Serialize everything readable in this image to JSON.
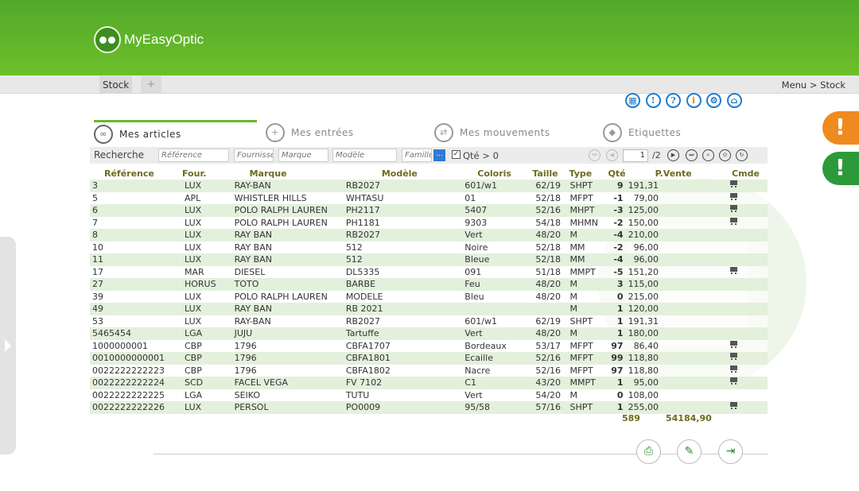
{
  "app": {
    "name": "MyEasyOptic"
  },
  "tabs": {
    "stock": "Stock",
    "add": "+"
  },
  "breadcrumb": "Menu > Stock",
  "toolbar_icons": [
    "calendar-icon",
    "info-icon",
    "help-icon",
    "info-orange-icon",
    "settings-icon",
    "home-icon"
  ],
  "alerts": {
    "orange": "!",
    "green": "!"
  },
  "nav": {
    "articles": "Mes articles",
    "entrees": "Mes entrées",
    "mouvements": "Mes mouvements",
    "etiquettes": "Etiquettes"
  },
  "search": {
    "label": "Recherche",
    "reference": "Référence",
    "fournisseur": "Fournisseur",
    "marque": "Marque",
    "modele": "Modèle",
    "famille": "Famille",
    "dots": "...",
    "qte_filter": "Qté > 0",
    "page": "1",
    "total_pages": "/2"
  },
  "columns": [
    "Référence",
    "Four.",
    "Marque",
    "Modèle",
    "Coloris",
    "Taille",
    "Type",
    "Qté",
    "P.Vente",
    "Cmde"
  ],
  "rows": [
    {
      "ref": "3",
      "four": "LUX",
      "marque": "RAY-BAN",
      "modele": "RB2027",
      "coloris": "601/w1",
      "taille": "62/19",
      "type": "SHPT",
      "qte": "9",
      "prix": "191,31",
      "cmde": true
    },
    {
      "ref": "5",
      "four": "APL",
      "marque": "WHISTLER HILLS",
      "modele": "WHTASU",
      "coloris": "01",
      "taille": "52/18",
      "type": "MFPT",
      "qte": "-1",
      "prix": "79,00",
      "cmde": true
    },
    {
      "ref": "6",
      "four": "LUX",
      "marque": "POLO RALPH LAUREN",
      "modele": "PH2117",
      "coloris": "5407",
      "taille": "52/16",
      "type": "MHPT",
      "qte": "-3",
      "prix": "125,00",
      "cmde": true
    },
    {
      "ref": "7",
      "four": "LUX",
      "marque": "POLO RALPH LAUREN",
      "modele": "PH1181",
      "coloris": "9303",
      "taille": "54/18",
      "type": "MHMN",
      "qte": "-2",
      "prix": "150,00",
      "cmde": true
    },
    {
      "ref": "8",
      "four": "LUX",
      "marque": "RAY BAN",
      "modele": "RB2027",
      "coloris": "Vert",
      "taille": "48/20",
      "type": "M",
      "qte": "-4",
      "prix": "210,00",
      "cmde": false
    },
    {
      "ref": "10",
      "four": "LUX",
      "marque": "RAY BAN",
      "modele": "512",
      "coloris": "Noire",
      "taille": "52/18",
      "type": "MM",
      "qte": "-2",
      "prix": "96,00",
      "cmde": false
    },
    {
      "ref": "11",
      "four": "LUX",
      "marque": "RAY BAN",
      "modele": "512",
      "coloris": "Bleue",
      "taille": "52/18",
      "type": "MM",
      "qte": "-4",
      "prix": "96,00",
      "cmde": false
    },
    {
      "ref": "17",
      "four": "MAR",
      "marque": "DIESEL",
      "modele": "DL5335",
      "coloris": "091",
      "taille": "51/18",
      "type": "MMPT",
      "qte": "-5",
      "prix": "151,20",
      "cmde": true
    },
    {
      "ref": "27",
      "four": "HORUS",
      "marque": "TOTO",
      "modele": "BARBE",
      "coloris": "Feu",
      "taille": "48/20",
      "type": "M",
      "qte": "3",
      "prix": "115,00",
      "cmde": false
    },
    {
      "ref": "39",
      "four": "LUX",
      "marque": "POLO RALPH LAUREN",
      "modele": "MODELE",
      "coloris": "Bleu",
      "taille": "48/20",
      "type": "M",
      "qte": "0",
      "prix": "215,00",
      "cmde": false
    },
    {
      "ref": "49",
      "four": "LUX",
      "marque": "RAY BAN",
      "modele": "RB 2021",
      "coloris": "",
      "taille": "",
      "type": "M",
      "qte": "1",
      "prix": "120,00",
      "cmde": false
    },
    {
      "ref": "53",
      "four": "LUX",
      "marque": "RAY-BAN",
      "modele": "RB2027",
      "coloris": "601/w1",
      "taille": "62/19",
      "type": "SHPT",
      "qte": "1",
      "prix": "191,31",
      "cmde": false
    },
    {
      "ref": "5465454",
      "four": "LGA",
      "marque": "JUJU",
      "modele": "Tartuffe",
      "coloris": "Vert",
      "taille": "48/20",
      "type": "M",
      "qte": "1",
      "prix": "180,00",
      "cmde": false
    },
    {
      "ref": "1000000001",
      "four": "CBP",
      "marque": "1796",
      "modele": "CBFA1707",
      "coloris": "Bordeaux",
      "taille": "53/17",
      "type": "MFPT",
      "qte": "97",
      "prix": "86,40",
      "cmde": true
    },
    {
      "ref": "0010000000001",
      "four": "CBP",
      "marque": "1796",
      "modele": "CBFA1801",
      "coloris": "Ecaille",
      "taille": "52/16",
      "type": "MFPT",
      "qte": "99",
      "prix": "118,80",
      "cmde": true
    },
    {
      "ref": "0022222222223",
      "four": "CBP",
      "marque": "1796",
      "modele": "CBFA1802",
      "coloris": "Nacre",
      "taille": "52/16",
      "type": "MFPT",
      "qte": "97",
      "prix": "118,80",
      "cmde": true
    },
    {
      "ref": "0022222222224",
      "four": "SCD",
      "marque": "FACEL VEGA",
      "modele": "FV 7102",
      "coloris": "C1",
      "taille": "43/20",
      "type": "MMPT",
      "qte": "1",
      "prix": "95,00",
      "cmde": true
    },
    {
      "ref": "0022222222225",
      "four": "LGA",
      "marque": "SEIKO",
      "modele": "TUTU",
      "coloris": "Vert",
      "taille": "54/20",
      "type": "M",
      "qte": "0",
      "prix": "108,00",
      "cmde": false
    },
    {
      "ref": "0022222222226",
      "four": "LUX",
      "marque": "PERSOL",
      "modele": "PO0009",
      "coloris": "95/58",
      "taille": "57/16",
      "type": "SHPT",
      "qte": "1",
      "prix": "255,00",
      "cmde": true
    }
  ],
  "totals": {
    "qte": "589",
    "prix": "54184,90"
  }
}
